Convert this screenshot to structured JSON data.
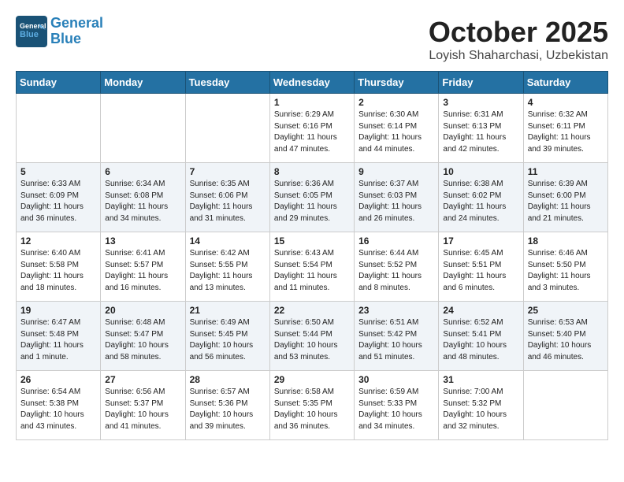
{
  "header": {
    "logo_line1": "General",
    "logo_line2": "Blue",
    "month": "October 2025",
    "location": "Loyish Shaharchasi, Uzbekistan"
  },
  "days_of_week": [
    "Sunday",
    "Monday",
    "Tuesday",
    "Wednesday",
    "Thursday",
    "Friday",
    "Saturday"
  ],
  "weeks": [
    [
      {
        "day": "",
        "text": ""
      },
      {
        "day": "",
        "text": ""
      },
      {
        "day": "",
        "text": ""
      },
      {
        "day": "1",
        "text": "Sunrise: 6:29 AM\nSunset: 6:16 PM\nDaylight: 11 hours and 47 minutes."
      },
      {
        "day": "2",
        "text": "Sunrise: 6:30 AM\nSunset: 6:14 PM\nDaylight: 11 hours and 44 minutes."
      },
      {
        "day": "3",
        "text": "Sunrise: 6:31 AM\nSunset: 6:13 PM\nDaylight: 11 hours and 42 minutes."
      },
      {
        "day": "4",
        "text": "Sunrise: 6:32 AM\nSunset: 6:11 PM\nDaylight: 11 hours and 39 minutes."
      }
    ],
    [
      {
        "day": "5",
        "text": "Sunrise: 6:33 AM\nSunset: 6:09 PM\nDaylight: 11 hours and 36 minutes."
      },
      {
        "day": "6",
        "text": "Sunrise: 6:34 AM\nSunset: 6:08 PM\nDaylight: 11 hours and 34 minutes."
      },
      {
        "day": "7",
        "text": "Sunrise: 6:35 AM\nSunset: 6:06 PM\nDaylight: 11 hours and 31 minutes."
      },
      {
        "day": "8",
        "text": "Sunrise: 6:36 AM\nSunset: 6:05 PM\nDaylight: 11 hours and 29 minutes."
      },
      {
        "day": "9",
        "text": "Sunrise: 6:37 AM\nSunset: 6:03 PM\nDaylight: 11 hours and 26 minutes."
      },
      {
        "day": "10",
        "text": "Sunrise: 6:38 AM\nSunset: 6:02 PM\nDaylight: 11 hours and 24 minutes."
      },
      {
        "day": "11",
        "text": "Sunrise: 6:39 AM\nSunset: 6:00 PM\nDaylight: 11 hours and 21 minutes."
      }
    ],
    [
      {
        "day": "12",
        "text": "Sunrise: 6:40 AM\nSunset: 5:58 PM\nDaylight: 11 hours and 18 minutes."
      },
      {
        "day": "13",
        "text": "Sunrise: 6:41 AM\nSunset: 5:57 PM\nDaylight: 11 hours and 16 minutes."
      },
      {
        "day": "14",
        "text": "Sunrise: 6:42 AM\nSunset: 5:55 PM\nDaylight: 11 hours and 13 minutes."
      },
      {
        "day": "15",
        "text": "Sunrise: 6:43 AM\nSunset: 5:54 PM\nDaylight: 11 hours and 11 minutes."
      },
      {
        "day": "16",
        "text": "Sunrise: 6:44 AM\nSunset: 5:52 PM\nDaylight: 11 hours and 8 minutes."
      },
      {
        "day": "17",
        "text": "Sunrise: 6:45 AM\nSunset: 5:51 PM\nDaylight: 11 hours and 6 minutes."
      },
      {
        "day": "18",
        "text": "Sunrise: 6:46 AM\nSunset: 5:50 PM\nDaylight: 11 hours and 3 minutes."
      }
    ],
    [
      {
        "day": "19",
        "text": "Sunrise: 6:47 AM\nSunset: 5:48 PM\nDaylight: 11 hours and 1 minute."
      },
      {
        "day": "20",
        "text": "Sunrise: 6:48 AM\nSunset: 5:47 PM\nDaylight: 10 hours and 58 minutes."
      },
      {
        "day": "21",
        "text": "Sunrise: 6:49 AM\nSunset: 5:45 PM\nDaylight: 10 hours and 56 minutes."
      },
      {
        "day": "22",
        "text": "Sunrise: 6:50 AM\nSunset: 5:44 PM\nDaylight: 10 hours and 53 minutes."
      },
      {
        "day": "23",
        "text": "Sunrise: 6:51 AM\nSunset: 5:42 PM\nDaylight: 10 hours and 51 minutes."
      },
      {
        "day": "24",
        "text": "Sunrise: 6:52 AM\nSunset: 5:41 PM\nDaylight: 10 hours and 48 minutes."
      },
      {
        "day": "25",
        "text": "Sunrise: 6:53 AM\nSunset: 5:40 PM\nDaylight: 10 hours and 46 minutes."
      }
    ],
    [
      {
        "day": "26",
        "text": "Sunrise: 6:54 AM\nSunset: 5:38 PM\nDaylight: 10 hours and 43 minutes."
      },
      {
        "day": "27",
        "text": "Sunrise: 6:56 AM\nSunset: 5:37 PM\nDaylight: 10 hours and 41 minutes."
      },
      {
        "day": "28",
        "text": "Sunrise: 6:57 AM\nSunset: 5:36 PM\nDaylight: 10 hours and 39 minutes."
      },
      {
        "day": "29",
        "text": "Sunrise: 6:58 AM\nSunset: 5:35 PM\nDaylight: 10 hours and 36 minutes."
      },
      {
        "day": "30",
        "text": "Sunrise: 6:59 AM\nSunset: 5:33 PM\nDaylight: 10 hours and 34 minutes."
      },
      {
        "day": "31",
        "text": "Sunrise: 7:00 AM\nSunset: 5:32 PM\nDaylight: 10 hours and 32 minutes."
      },
      {
        "day": "",
        "text": ""
      }
    ]
  ]
}
